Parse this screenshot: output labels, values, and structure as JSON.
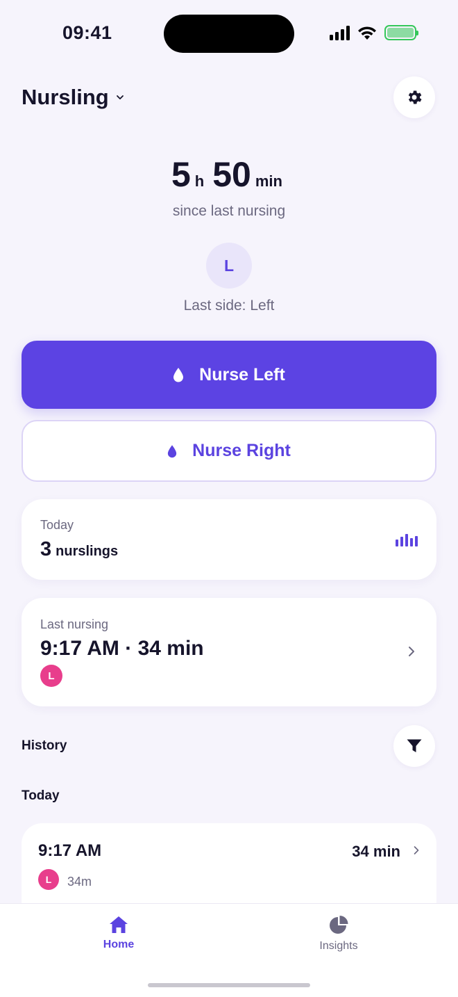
{
  "status_bar": {
    "time": "09:41"
  },
  "header": {
    "title": "Nursling"
  },
  "timer": {
    "hours": "5",
    "hours_unit": "h",
    "minutes": "50",
    "minutes_unit": "min",
    "caption": "since last nursing"
  },
  "last_side": {
    "badge": "L",
    "label": "Last side: Left"
  },
  "actions": {
    "primary_label": "Nurse Left",
    "secondary_label": "Nurse Right"
  },
  "today_card": {
    "label": "Today",
    "count": "3",
    "unit": "nurslings"
  },
  "last_nursing_card": {
    "label": "Last nursing",
    "summary": "9:17 AM · 34 min",
    "side_badge": "L"
  },
  "history": {
    "title": "History",
    "groups": [
      {
        "label": "Today",
        "entries": [
          {
            "time": "9:17 AM",
            "duration": "34 min",
            "side_badge": "L",
            "meta": "34m"
          }
        ]
      }
    ]
  },
  "tab_bar": {
    "tabs": [
      {
        "label": "Home",
        "icon": "home-icon",
        "active": true
      },
      {
        "label": "Insights",
        "icon": "pie-chart-icon",
        "active": false
      }
    ]
  },
  "colors": {
    "accent": "#5c43e3",
    "side_left_pink": "#e83e8c",
    "background": "#f6f4fc"
  }
}
